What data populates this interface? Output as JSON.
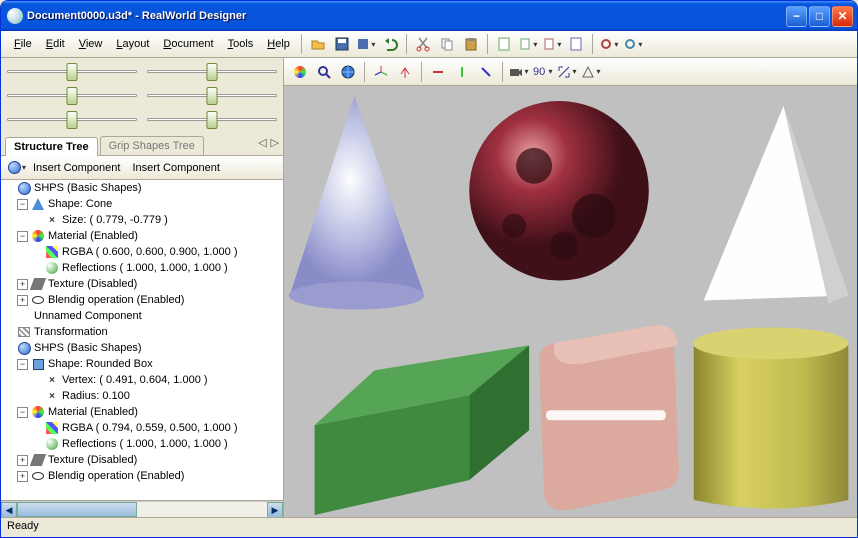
{
  "window": {
    "title": "Document0000.u3d* - RealWorld Designer"
  },
  "menu": {
    "file": "File",
    "edit": "Edit",
    "view": "View",
    "layout": "Layout",
    "document": "Document",
    "tools": "Tools",
    "help": "Help"
  },
  "tabs": {
    "structure": "Structure Tree",
    "grip": "Grip Shapes Tree"
  },
  "actions": {
    "insert1": "Insert Component",
    "insert2": "Insert Component"
  },
  "tree": [
    {
      "d": 0,
      "exp": "",
      "icon": "i-shps",
      "label": "SHPS (Basic Shapes)"
    },
    {
      "d": 1,
      "exp": "−",
      "icon": "i-shape",
      "label": "Shape: Cone"
    },
    {
      "d": 2,
      "exp": "",
      "icon": "i-x",
      "label": "Size: ( 0.779, -0.779 )"
    },
    {
      "d": 1,
      "exp": "−",
      "icon": "i-mat",
      "label": "Material (Enabled)"
    },
    {
      "d": 2,
      "exp": "",
      "icon": "i-rgba",
      "label": "RGBA ( 0.600, 0.600, 0.900, 1.000 )"
    },
    {
      "d": 2,
      "exp": "",
      "icon": "i-refl",
      "label": "Reflections ( 1.000, 1.000, 1.000 )"
    },
    {
      "d": 1,
      "exp": "+",
      "icon": "i-tex",
      "label": "Texture (Disabled)"
    },
    {
      "d": 1,
      "exp": "+",
      "icon": "i-blend",
      "label": "Blendig operation (Enabled)"
    },
    {
      "d": 0,
      "exp": "",
      "icon": "",
      "label": "Unnamed Component"
    },
    {
      "d": 0,
      "exp": "",
      "icon": "i-comp",
      "label": "Transformation"
    },
    {
      "d": 0,
      "exp": "",
      "icon": "i-shps",
      "label": "SHPS (Basic Shapes)"
    },
    {
      "d": 1,
      "exp": "−",
      "icon": "i-box",
      "label": "Shape: Rounded Box"
    },
    {
      "d": 2,
      "exp": "",
      "icon": "i-x",
      "label": "Vertex: ( 0.491, 0.604, 1.000 )"
    },
    {
      "d": 2,
      "exp": "",
      "icon": "i-x",
      "label": "Radius: 0.100"
    },
    {
      "d": 1,
      "exp": "−",
      "icon": "i-mat",
      "label": "Material (Enabled)"
    },
    {
      "d": 2,
      "exp": "",
      "icon": "i-rgba",
      "label": "RGBA ( 0.794, 0.559, 0.500, 1.000 )"
    },
    {
      "d": 2,
      "exp": "",
      "icon": "i-refl",
      "label": "Reflections ( 1.000, 1.000, 1.000 )"
    },
    {
      "d": 1,
      "exp": "+",
      "icon": "i-tex",
      "label": "Texture (Disabled)"
    },
    {
      "d": 1,
      "exp": "+",
      "icon": "i-blend",
      "label": "Blendig operation (Enabled)"
    }
  ],
  "status": "Ready",
  "nav": {
    "prev": "◁",
    "next": "▷"
  }
}
